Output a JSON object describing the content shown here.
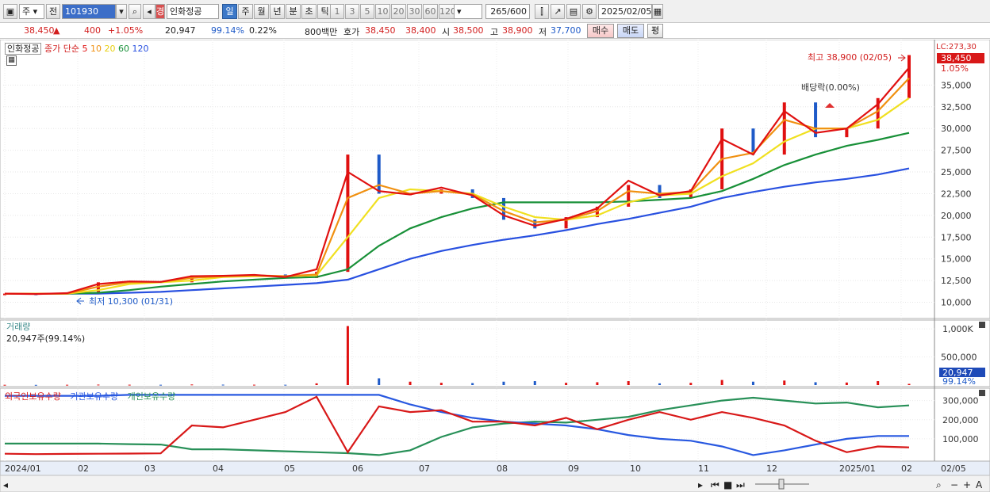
{
  "toolbar": {
    "period_type": "주",
    "prev_label": "전",
    "code": "101930",
    "stock_name": "인화정공",
    "stock_badge": "경",
    "interval_tabs": [
      "일",
      "주",
      "월",
      "년",
      "분",
      "초",
      "틱"
    ],
    "active_interval": "일",
    "minute_options": [
      "1",
      "3",
      "5",
      "10",
      "20",
      "30",
      "60",
      "120"
    ],
    "count_current": "265",
    "count_total": "/600",
    "date": "2025/02/05"
  },
  "quote": {
    "price": "38,450",
    "change_arrow": "▲",
    "change": "400",
    "change_pct": "+1.05%",
    "volume": "20,947",
    "volume_ratio": "99.14%",
    "turnover_pct": "0.22%",
    "amount": "800백만",
    "bid_label": "호가",
    "ask_price": "38,450",
    "bid_price": "38,400",
    "open_label": "시",
    "open": "38,500",
    "high_label": "고",
    "high": "38,900",
    "low_label": "저",
    "low": "37,700",
    "buy_button": "매수",
    "sell_button": "매도",
    "avg_button": "평"
  },
  "price_legend": {
    "name": "인화정공",
    "type": "종가 단순",
    "ma_periods": [
      "5",
      "10",
      "20",
      "60",
      "120"
    ],
    "ma_colors": [
      "#e01010",
      "#f09010",
      "#f0e020",
      "#189038",
      "#2850e0"
    ]
  },
  "annotations": {
    "high_marker": "최고 38,900 (02/05)",
    "low_marker": "최저 10,300 (01/31)",
    "dividend": "배당락(0.00%)",
    "lc_label": "LC:273,30",
    "current_price_tag": "38,450",
    "current_pct_tag": "1.05%"
  },
  "volume_panel": {
    "title": "거래량",
    "value": "20,947주(99.14%)",
    "axis_labels": [
      "1,000K",
      "500,000"
    ],
    "current_tag": "20,947",
    "current_pct": "99.14%"
  },
  "holding_panel": {
    "series": [
      "외국인보유수량",
      "기관보유수량",
      "개인보유수량"
    ],
    "colors": [
      "#d81818",
      "#2858e0",
      "#289058"
    ],
    "axis_labels": [
      "300,000",
      "200,000",
      "100,000"
    ]
  },
  "x_axis": [
    "2024/01",
    "02",
    "03",
    "04",
    "05",
    "06",
    "07",
    "08",
    "09",
    "10",
    "11",
    "12",
    "2025/01",
    "02",
    "02/05"
  ],
  "chart_data": {
    "type": "line",
    "price_axis": {
      "ticks": [
        10000,
        12500,
        15000,
        17500,
        20000,
        22500,
        25000,
        27500,
        30000,
        32500,
        35000
      ],
      "tick_labels": [
        "10,000",
        "12,500",
        "15,000",
        "17,500",
        "20,000",
        "22,500",
        "25,000",
        "27,500",
        "30,000",
        "32,500",
        "35,000"
      ],
      "ylim": [
        8500,
        39500
      ]
    },
    "x_months": [
      "2024/01",
      "02",
      "03",
      "04",
      "05",
      "06",
      "07",
      "08",
      "09",
      "10",
      "11",
      "12",
      "2025/01",
      "02"
    ],
    "close": [
      11000,
      10900,
      11100,
      12300,
      12400,
      12300,
      13100,
      13000,
      13200,
      12800,
      13500,
      27000,
      22500,
      22500,
      23000,
      22000,
      19500,
      18500,
      19800,
      21000,
      23500,
      22000,
      23000,
      30000,
      27000,
      33000,
      29000,
      30000,
      33500,
      38450
    ],
    "ma5": [
      11000,
      10950,
      11050,
      12100,
      12400,
      12350,
      13000,
      13050,
      13150,
      12900,
      13800,
      25000,
      22800,
      22400,
      23200,
      22300,
      20000,
      18800,
      19600,
      20800,
      24000,
      22300,
      22800,
      28800,
      27000,
      32000,
      29500,
      30000,
      32800,
      37000
    ],
    "ma10": [
      11000,
      10980,
      11000,
      11800,
      12300,
      12350,
      12800,
      13000,
      13100,
      13000,
      13200,
      22000,
      23500,
      22500,
      22800,
      22400,
      20500,
      19200,
      19500,
      20500,
      22800,
      22500,
      22700,
      26500,
      27200,
      31000,
      30000,
      30000,
      32000,
      35800
    ],
    "ma20": [
      11000,
      11000,
      11000,
      11400,
      12100,
      12300,
      12500,
      12900,
      13000,
      13000,
      13100,
      17500,
      22000,
      23000,
      22800,
      22500,
      21000,
      19800,
      19500,
      20000,
      21500,
      22300,
      22500,
      24500,
      26000,
      28500,
      30000,
      30000,
      31000,
      33500
    ],
    "ma60": [
      11000,
      11000,
      11000,
      11100,
      11400,
      11800,
      12100,
      12400,
      12600,
      12800,
      12900,
      13800,
      16500,
      18500,
      19800,
      20800,
      21500,
      21500,
      21500,
      21500,
      21600,
      21800,
      22000,
      22800,
      24200,
      25800,
      27000,
      28000,
      28700,
      29500
    ],
    "ma120": [
      11000,
      11000,
      11000,
      11000,
      11100,
      11200,
      11400,
      11600,
      11800,
      12000,
      12200,
      12600,
      13800,
      15000,
      15900,
      16600,
      17200,
      17700,
      18300,
      19000,
      19600,
      20300,
      21000,
      22000,
      22700,
      23300,
      23800,
      24200,
      24700,
      25400
    ],
    "volume": [
      4,
      3,
      5,
      8,
      6,
      5,
      10,
      7,
      6,
      5,
      30,
      1050,
      120,
      60,
      40,
      35,
      60,
      70,
      40,
      50,
      70,
      30,
      40,
      90,
      60,
      80,
      50,
      45,
      70,
      21
    ],
    "foreign_holding": [
      22000,
      20000,
      21000,
      22000,
      23000,
      24000,
      170000,
      160000,
      200000,
      240000,
      320000,
      30000,
      270000,
      240000,
      250000,
      190000,
      190000,
      170000,
      210000,
      150000,
      200000,
      240000,
      200000,
      240000,
      210000,
      170000,
      90000,
      30000,
      60000,
      55000
    ],
    "institution_holding": [
      325000,
      325000,
      325000,
      325000,
      330000,
      330000,
      330000,
      330000,
      330000,
      330000,
      330000,
      330000,
      330000,
      280000,
      240000,
      210000,
      190000,
      180000,
      170000,
      150000,
      120000,
      100000,
      90000,
      60000,
      15000,
      40000,
      70000,
      100000,
      115000,
      115000
    ],
    "individual_holding": [
      75000,
      75000,
      75000,
      75000,
      72000,
      70000,
      45000,
      45000,
      40000,
      35000,
      30000,
      25000,
      15000,
      40000,
      110000,
      160000,
      180000,
      190000,
      185000,
      200000,
      215000,
      250000,
      275000,
      300000,
      315000,
      300000,
      285000,
      290000,
      265000,
      275000
    ],
    "holding_axis": {
      "ticks": [
        100000,
        200000,
        300000
      ],
      "ylim": [
        0,
        340000
      ]
    },
    "volume_axis": {
      "ticks": [
        500000,
        1000000
      ],
      "ylim": [
        0,
        1100000
      ]
    }
  }
}
